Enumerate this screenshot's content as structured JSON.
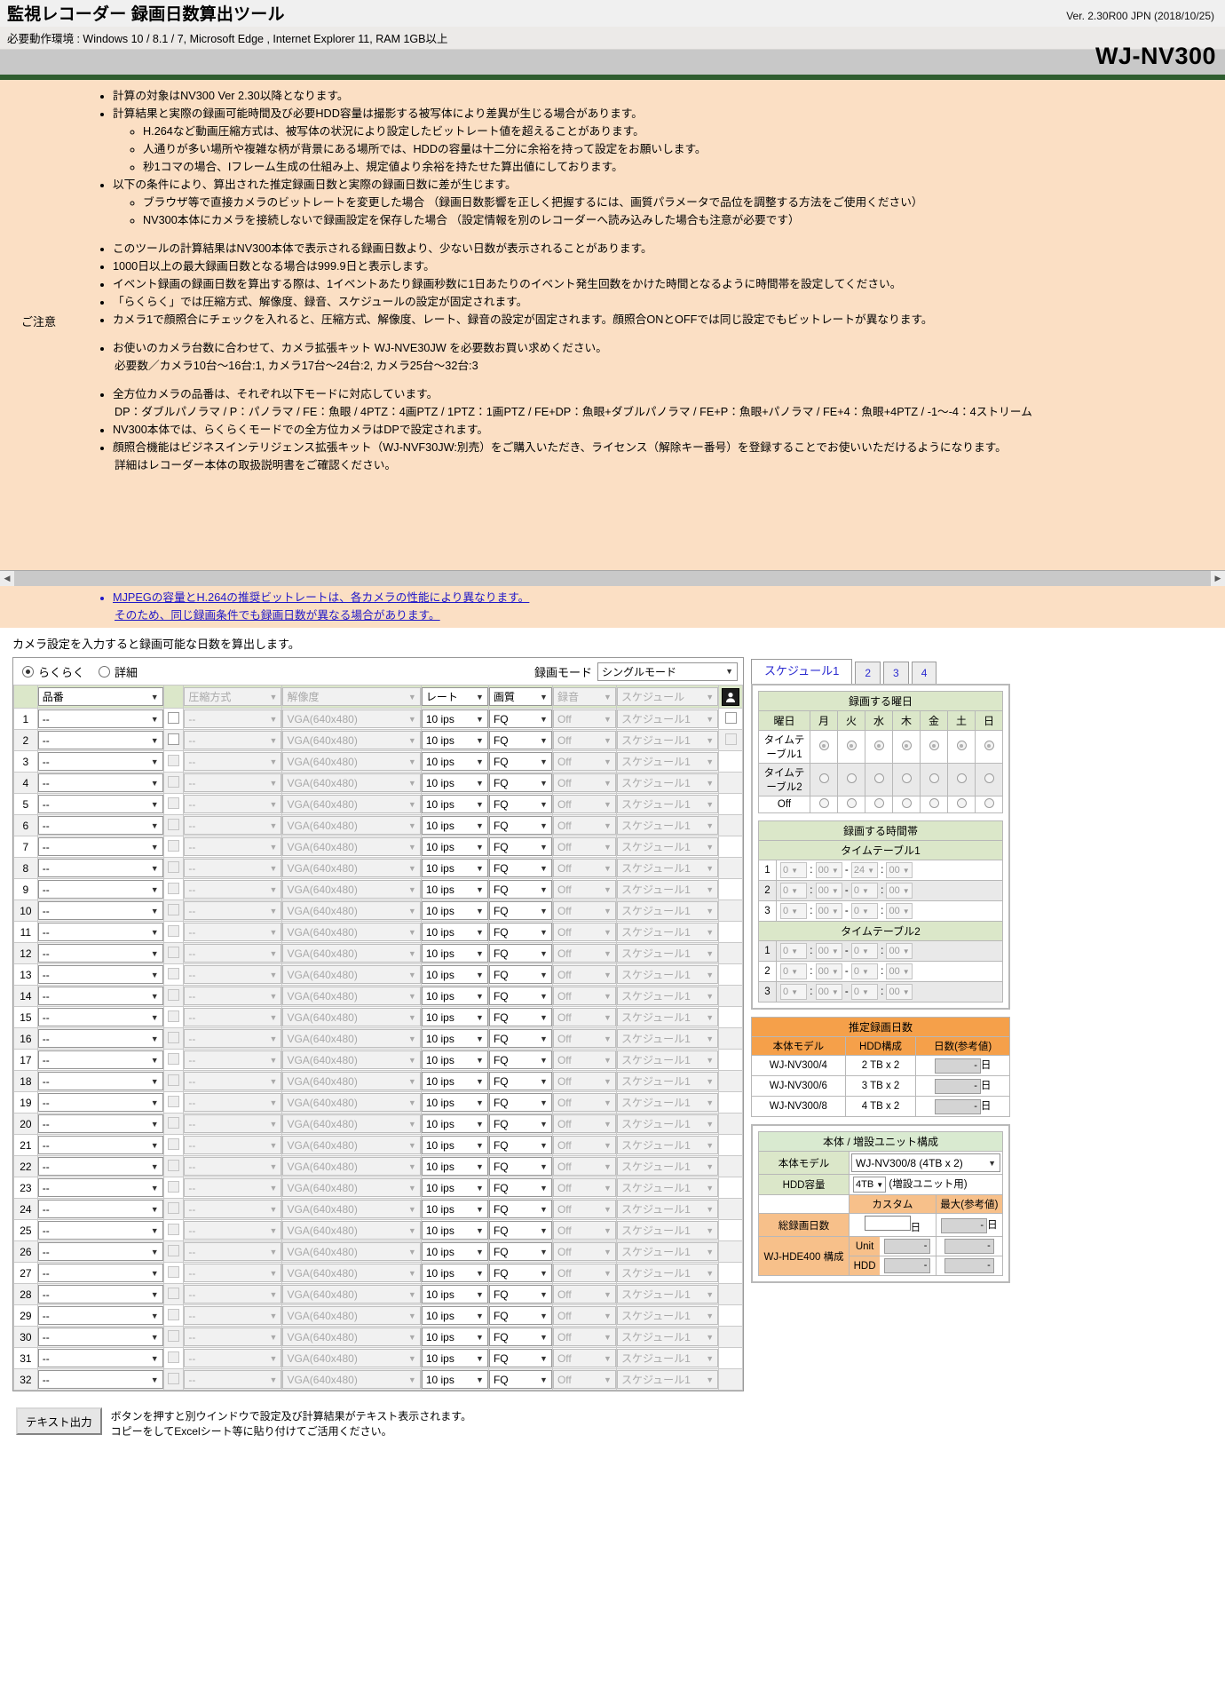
{
  "header": {
    "title": "監視レコーダー 録画日数算出ツール",
    "version": "Ver. 2.30R00 JPN (2018/10/25)",
    "environment": "必要動作環境 : Windows 10 / 8.1 / 7, Microsoft Edge , Internet Explorer 11, RAM 1GB以上",
    "model": "WJ-NV300"
  },
  "notice": {
    "label": "ご注意",
    "items": [
      "計算の対象はNV300 Ver 2.30以降となります。",
      "計算結果と実際の録画可能時間及び必要HDD容量は撮影する被写体により差異が生じる場合があります。",
      "以下の条件により、算出された推定録画日数と実際の録画日数に差が生じます。",
      "このツールの計算結果はNV300本体で表示される録画日数より、少ない日数が表示されることがあります。",
      "1000日以上の最大録画日数となる場合は999.9日と表示します。",
      "イベント録画の録画日数を算出する際は、1イベントあたり録画秒数に1日あたりのイベント発生回数をかけた時間となるように時間帯を設定してください。",
      "「らくらく」では圧縮方式、解像度、録音、スケジュールの設定が固定されます。",
      "カメラ1で顔照合にチェックを入れると、圧縮方式、解像度、レート、録音の設定が固定されます。顔照合ONとOFFでは同じ設定でもビットレートが異なります。",
      "お使いのカメラ台数に合わせて、カメラ拡張キット WJ-NVE30JW を必要数お買い求めください。",
      "全方位カメラの品番は、それぞれ以下モードに対応しています。",
      "NV300本体では、らくらくモードでの全方位カメラはDPで設定されます。",
      "顔照合機能はビジネスインテリジェンス拡張キット（WJ-NVF30JW:別売）をご購入いただき、ライセンス（解除キー番号）を登録することでお使いいただけるようになります。"
    ],
    "sub_items_2": [
      "H.264など動画圧縮方式は、被写体の状況により設定したビットレート値を超えることがあります。",
      "人通りが多い場所や複雑な柄が背景にある場所では、HDDの容量は十二分に余裕を持って設定をお願いします。",
      "秒1コマの場合、Iフレーム生成の仕組み上、規定値より余裕を持たせた算出値にしております。"
    ],
    "sub_items_3": [
      "ブラウザ等で直接カメラのビットレートを変更した場合 （録画日数影響を正しく把握するには、画質パラメータで品位を調整する方法をご使用ください）",
      "NV300本体にカメラを接続しないで録画設定を保存した場合 （設定情報を別のレコーダーへ読み込みした場合も注意が必要です）"
    ],
    "kit_detail": "必要数／カメラ10台〜16台:1, カメラ17台〜24台:2, カメラ25台〜32台:3",
    "omni_detail": "DP：ダブルパノラマ / P：パノラマ / FE：魚眼 / 4PTZ：4画PTZ / 1PTZ：1画PTZ / FE+DP：魚眼+ダブルパノラマ / FE+P：魚眼+パノラマ / FE+4：魚眼+4PTZ / -1〜-4：4ストリーム",
    "manual_line": "詳細はレコーダー本体の取扱説明書をご確認ください。",
    "link_line1": "MJPEGの容量とH.264の推奨ビットレートは、各カメラの性能により異なります。",
    "link_line2": "そのため、同じ録画条件でも録画日数が異なる場合があります。"
  },
  "intro": "カメラ設定を入力すると録画可能な日数を算出します。",
  "left_panel": {
    "mode_radios": [
      {
        "label": "らくらく",
        "selected": true
      },
      {
        "label": "詳細",
        "selected": false
      }
    ],
    "recmode_label": "録画モード",
    "recmode_value": "シングルモード",
    "columns": {
      "model": "品番",
      "compression": "圧縮方式",
      "resolution": "解像度",
      "rate": "レート",
      "quality": "画質",
      "audio": "録音",
      "schedule": "スケジュール"
    },
    "face_icon": "face-match-icon",
    "defaults": {
      "model": "--",
      "compression": "--",
      "resolution": "VGA(640x480)",
      "rate": "10 ips",
      "quality": "FQ",
      "audio": "Off",
      "schedule": "スケジュール1"
    },
    "row_numbers": [
      1,
      2,
      3,
      4,
      5,
      6,
      7,
      8,
      9,
      10,
      11,
      12,
      13,
      14,
      15,
      16,
      17,
      18,
      19,
      20,
      21,
      22,
      23,
      24,
      25,
      26,
      27,
      28,
      29,
      30,
      31,
      32
    ]
  },
  "right_panel": {
    "tabs": [
      {
        "label": "スケジュール1",
        "active": true
      },
      {
        "label": "2",
        "active": false
      },
      {
        "label": "3",
        "active": false
      },
      {
        "label": "4",
        "active": false
      }
    ],
    "weekday_table": {
      "title": "録画する曜日",
      "header": [
        "曜日",
        "月",
        "火",
        "水",
        "木",
        "金",
        "土",
        "日"
      ],
      "rows": [
        {
          "label": "タイムテーブル1",
          "selected": true
        },
        {
          "label": "タイムテーブル2",
          "selected": false
        },
        {
          "label": "Off",
          "selected": false
        }
      ]
    },
    "time_table": {
      "title": "録画する時間帯",
      "tt1_title": "タイムテーブル1",
      "tt2_title": "タイムテーブル2",
      "tt1_rows": [
        {
          "no": "1",
          "from_h": "0",
          "from_m": "00",
          "to_h": "24",
          "to_m": "00"
        },
        {
          "no": "2",
          "from_h": "0",
          "from_m": "00",
          "to_h": "0",
          "to_m": "00"
        },
        {
          "no": "3",
          "from_h": "0",
          "from_m": "00",
          "to_h": "0",
          "to_m": "00"
        }
      ],
      "tt2_rows": [
        {
          "no": "1",
          "from_h": "0",
          "from_m": "00",
          "to_h": "0",
          "to_m": "00"
        },
        {
          "no": "2",
          "from_h": "0",
          "from_m": "00",
          "to_h": "0",
          "to_m": "00"
        },
        {
          "no": "3",
          "from_h": "0",
          "from_m": "00",
          "to_h": "0",
          "to_m": "00"
        }
      ]
    },
    "estimate_table": {
      "title": "推定録画日数",
      "header": [
        "本体モデル",
        "HDD構成",
        "日数(参考値)"
      ],
      "rows": [
        {
          "model": "WJ-NV300/4",
          "hdd": "2 TB x 2",
          "days": "-",
          "unit": "日"
        },
        {
          "model": "WJ-NV300/6",
          "hdd": "3 TB x 2",
          "days": "-",
          "unit": "日"
        },
        {
          "model": "WJ-NV300/8",
          "hdd": "4 TB x 2",
          "days": "-",
          "unit": "日"
        }
      ]
    },
    "unit_config": {
      "title": "本体 / 増設ユニット構成",
      "model_label": "本体モデル",
      "model_value": "WJ-NV300/8 (4TB x 2)",
      "hdd_label": "HDD容量",
      "hdd_value": "4TB",
      "hdd_suffix": "(増設ユニット用)",
      "col_custom": "カスタム",
      "col_max": "最大(参考値)",
      "total_days_label": "総録画日数",
      "total_days_custom": "",
      "total_days_unit": "日",
      "total_days_max": "-",
      "total_days_max_unit": "日",
      "hde_label": "WJ-HDE400 構成",
      "unit_label": "Unit",
      "unit_custom": "-",
      "unit_max": "-",
      "hdd_row_label": "HDD",
      "hdd_custom": "-",
      "hdd_max": "-"
    }
  },
  "footer": {
    "button": "テキスト出力",
    "line1": "ボタンを押すと別ウインドウで設定及び計算結果がテキスト表示されます。",
    "line2": "コピーをしてExcelシート等に貼り付けてご活用ください。"
  }
}
